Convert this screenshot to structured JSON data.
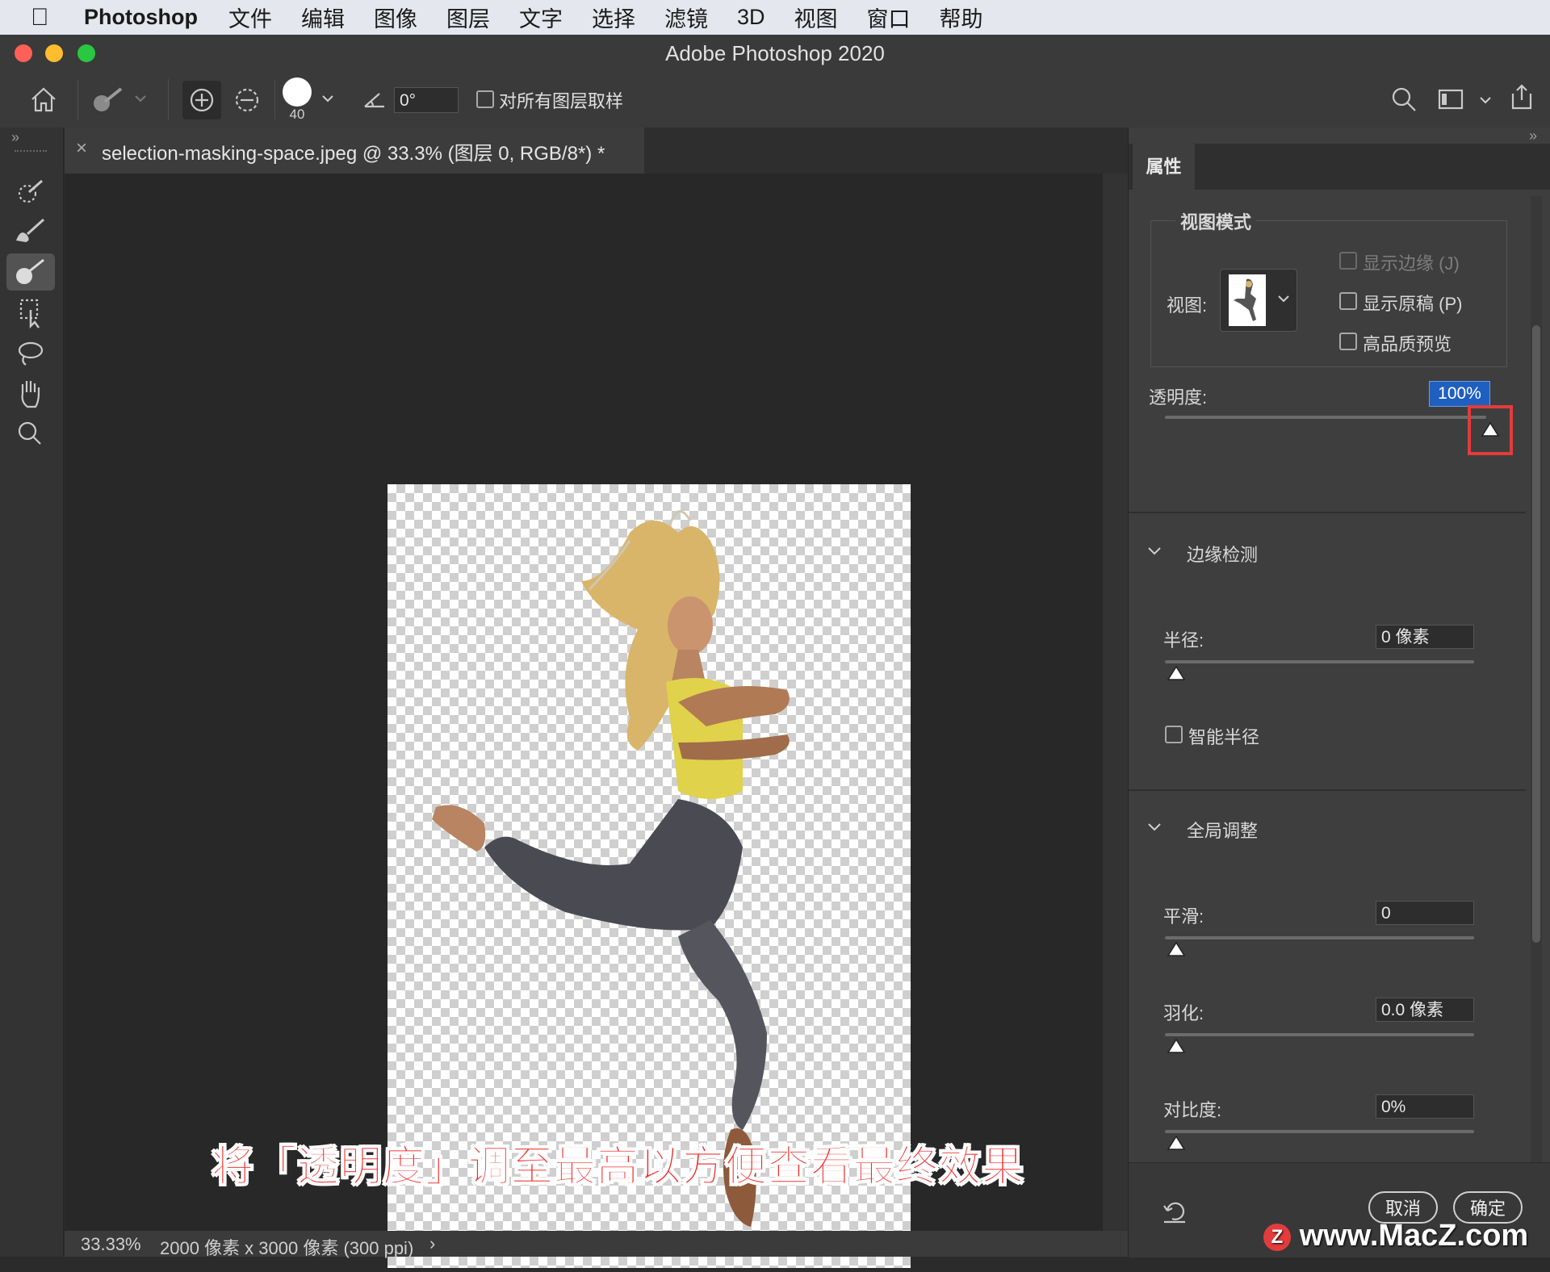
{
  "menubar": {
    "app_name": "Photoshop",
    "items": [
      "文件",
      "编辑",
      "图像",
      "图层",
      "文字",
      "选择",
      "滤镜",
      "3D",
      "视图",
      "窗口",
      "帮助"
    ]
  },
  "window": {
    "title": "Adobe Photoshop 2020"
  },
  "options": {
    "brush_size": "40",
    "angle_value": "0°",
    "sample_all_layers_label": "对所有图层取样"
  },
  "document": {
    "tab_title": "selection-masking-space.jpeg @ 33.3% (图层 0, RGB/8*) *"
  },
  "status": {
    "zoom": "33.33%",
    "doc_info": "2000 像素 x 3000 像素 (300 ppi)"
  },
  "caption": "将「透明度」调至最高以方便查看最终效果",
  "properties": {
    "tab_label": "属性",
    "view_mode": {
      "title": "视图模式",
      "view_label": "视图:",
      "show_edge": "显示边缘 (J)",
      "show_original": "显示原稿 (P)",
      "high_quality": "高品质预览"
    },
    "opacity": {
      "label": "透明度:",
      "value": "100%",
      "level": 1.0
    },
    "edge_detection": {
      "title": "边缘检测",
      "radius_label": "半径:",
      "radius_value": "0 像素",
      "smart_radius": "智能半径"
    },
    "global_refinements": {
      "title": "全局调整",
      "smooth_label": "平滑:",
      "smooth_value": "0",
      "feather_label": "羽化:",
      "feather_value": "0.0 像素",
      "contrast_label": "对比度:",
      "contrast_value": "0%"
    },
    "cancel": "取消",
    "ok": "确定"
  },
  "watermark": "www.MacZ.com",
  "colors": {
    "highlight_box": "#e23c3c",
    "selection_blue": "#1f5fbf",
    "caption_red": "#ef2d2d"
  }
}
